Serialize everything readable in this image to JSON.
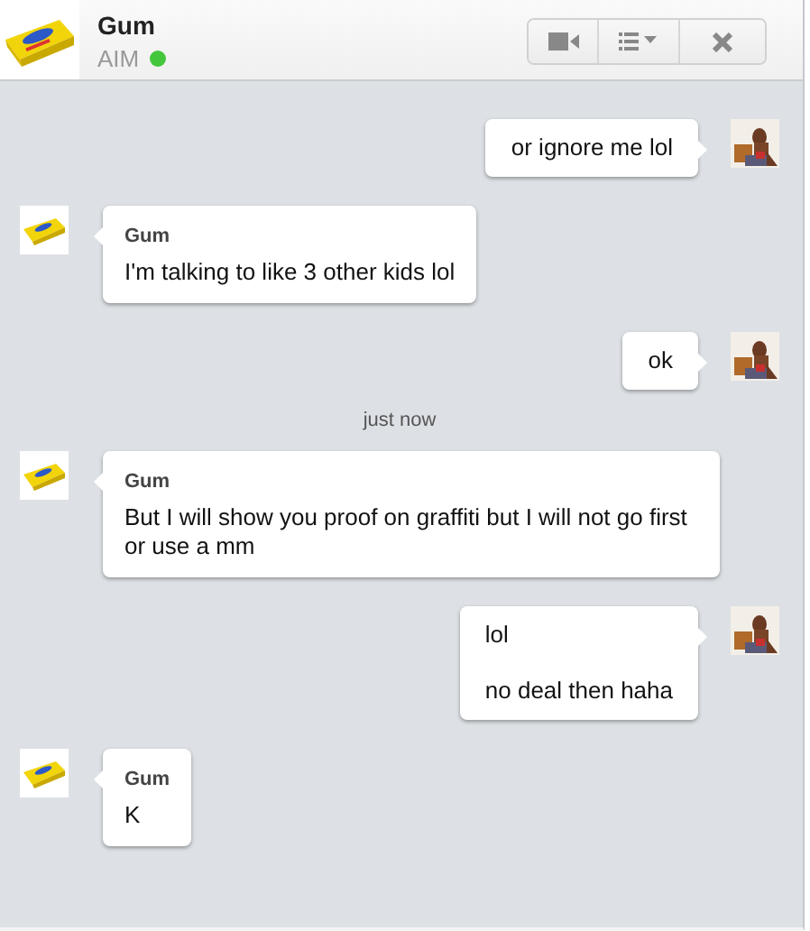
{
  "contact": {
    "name": "Gum",
    "service": "AIM",
    "online": true
  },
  "toolbar": [
    {
      "kind": "video"
    },
    {
      "kind": "list"
    },
    {
      "kind": "close"
    }
  ],
  "messages": [
    {
      "kind": "outgoing",
      "lines": [
        "or ignore me lol"
      ]
    },
    {
      "kind": "incoming",
      "sender": "Gum",
      "lines": [
        "I'm talking to like 3 other kids lol"
      ]
    },
    {
      "kind": "outgoing",
      "lines": [
        "ok"
      ]
    },
    {
      "kind": "timestamp",
      "text": "just now"
    },
    {
      "kind": "incoming",
      "sender": "Gum",
      "lines": [
        "But I will show you proof on graffiti but I will not go first or use a mm"
      ]
    },
    {
      "kind": "outgoing",
      "lines": [
        "lol",
        "no deal then haha"
      ]
    },
    {
      "kind": "incoming",
      "sender": "Gum",
      "lines": [
        "K"
      ]
    }
  ]
}
